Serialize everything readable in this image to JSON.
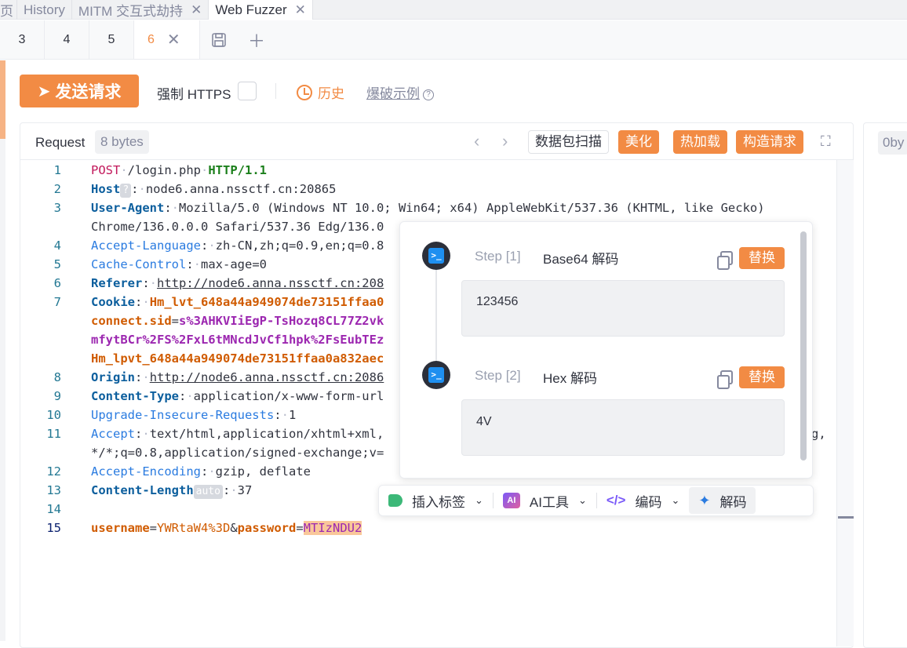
{
  "top_tabs": [
    {
      "label": "页",
      "closable": false
    },
    {
      "label": "History",
      "closable": false
    },
    {
      "label": "MITM 交互式劫持",
      "closable": true
    },
    {
      "label": "Web Fuzzer",
      "closable": true,
      "active": true
    }
  ],
  "sub_tabs": [
    "3",
    "4",
    "5",
    "6"
  ],
  "active_sub_tab": "6",
  "toolbar": {
    "send_label": "发送请求",
    "force_https_label": "强制 HTTPS",
    "history_label": "历史",
    "example_label": "爆破示例"
  },
  "request_panel": {
    "title": "Request",
    "size": "8 bytes",
    "buttons": {
      "scan": "数据包扫描",
      "beautify": "美化",
      "hot_reload": "热加载",
      "build": "构造请求"
    }
  },
  "code": {
    "line_numbers": [
      "1",
      "2",
      "3",
      "",
      "4",
      "5",
      "6",
      "7",
      "",
      "",
      "",
      "8",
      "9",
      "10",
      "11",
      "",
      "12",
      "13",
      "14",
      "15"
    ],
    "method": "POST",
    "path": "/login.php",
    "protocol": "HTTP/1.1",
    "host_key": "Host",
    "host_tag": "?",
    "host_val": "node6.anna.nssctf.cn:20865",
    "ua_key": "User-Agent",
    "ua_val1": "Mozilla/5.0 (Windows NT 10.0; Win64; x64) AppleWebKit/537.36 (KHTML, like Gecko)",
    "ua_val2": "Chrome/136.0.0.0 Safari/537.36 Edg/136.0",
    "al_key": "Accept-Language",
    "al_val": "zh-CN,zh;q=0.9,en;q=0.8",
    "cc_key": "Cache-Control",
    "cc_val": "max-age=0",
    "ref_key": "Referer",
    "ref_val": "http://node6.anna.nssctf.cn:208",
    "cookie_key": "Cookie",
    "cookie_1": "Hm_lvt_648a44a949074de73151ffaa0",
    "cookie_2k": "connect.sid",
    "cookie_2v": "s%3AHKVIiEgP-TsHozq8CL77Z2vk",
    "cookie_3": "mfytBCr%2FS%2FxL6tMNcdJvCf1hpk%2FsEubTEz",
    "cookie_4": "Hm_lpvt_648a44a949074de73151ffaa0a832aec",
    "origin_key": "Origin",
    "origin_val": "http://node6.anna.nssctf.cn:2086",
    "ct_key": "Content-Type",
    "ct_val": "application/x-www-form-url",
    "uir_key": "Upgrade-Insecure-Requests",
    "uir_val": "1",
    "accept_key": "Accept",
    "accept_val": "text/html,application/xhtml+xml,",
    "accept_tail": "g,",
    "accept_val2": "*/*;q=0.8,application/signed-exchange;v=",
    "ae_key": "Accept-Encoding",
    "ae_val": "gzip, deflate",
    "cl_key": "Content-Length",
    "cl_tag": "auto",
    "cl_val": "37",
    "body_k1": "username",
    "body_v1": "YWRtaW4%3D",
    "body_amp": "&",
    "body_k2": "password",
    "body_v2": "MTIzNDU2"
  },
  "right_panel": {
    "size": "0by"
  },
  "decode_popup": {
    "steps": [
      {
        "step": "Step [1]",
        "name": "Base64 解码",
        "replace": "替换",
        "result": "123456"
      },
      {
        "step": "Step [2]",
        "name": "Hex 解码",
        "replace": "替换",
        "result": "\u00124V"
      }
    ]
  },
  "menu": {
    "insert_tag": "插入标签",
    "ai_tools": "AI工具",
    "encode": "编码",
    "decode": "解码"
  },
  "colors": {
    "accent": "#f28b44",
    "key_blue": "#0b5e9d",
    "cookie_orange": "#d05b00",
    "cookie_purple": "#9c27b0"
  }
}
